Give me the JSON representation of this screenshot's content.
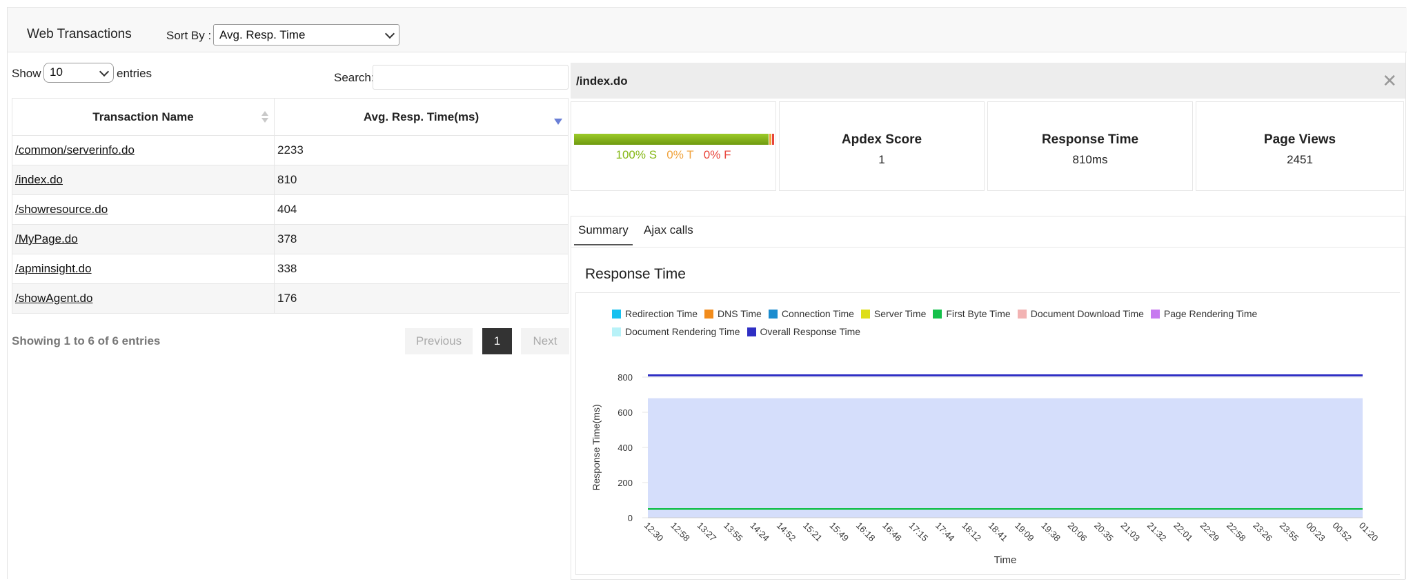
{
  "header": {
    "title": "Web Transactions",
    "sort_by_label": "Sort By :",
    "sort_by_value": "Avg. Resp. Time"
  },
  "table_controls": {
    "show_label": "Show",
    "show_value": "10",
    "entries_label": "entries",
    "search_label": "Search:",
    "search_value": ""
  },
  "table": {
    "columns": [
      "Transaction Name",
      "Avg. Resp. Time(ms)"
    ],
    "rows": [
      {
        "name": "/common/serverinfo.do",
        "value": "2233"
      },
      {
        "name": "/index.do",
        "value": "810"
      },
      {
        "name": "/showresource.do",
        "value": "404"
      },
      {
        "name": "/MyPage.do",
        "value": "378"
      },
      {
        "name": "/apminsight.do",
        "value": "338"
      },
      {
        "name": "/showAgent.do",
        "value": "176"
      }
    ]
  },
  "pagination": {
    "summary": "Showing 1 to 6 of 6 entries",
    "previous": "Previous",
    "current_page": "1",
    "next": "Next"
  },
  "detail": {
    "path": "/index.do",
    "close_icon": "close-icon",
    "apdex_breakdown": {
      "satisfied": "100% S",
      "tolerating": "0% T",
      "frustrated": "0% F",
      "colors": {
        "satisfied": "#86b817",
        "tolerating": "#f0a33d",
        "frustrated": "#e8443a"
      }
    },
    "cards": [
      {
        "title": "Apdex Score",
        "value": "1"
      },
      {
        "title": "Response Time",
        "value": "810ms"
      },
      {
        "title": "Page Views",
        "value": "2451"
      }
    ],
    "tabs": [
      "Summary",
      "Ajax calls"
    ],
    "chart_title": "Response Time"
  },
  "chart_data": {
    "type": "area",
    "xlabel": "Time",
    "ylabel": "Response Time(ms)",
    "ylim": [
      0,
      800
    ],
    "yticks": [
      0,
      200,
      400,
      600,
      800
    ],
    "x": [
      "12:30",
      "12:58",
      "13:27",
      "13:55",
      "14:24",
      "14:52",
      "15:21",
      "15:49",
      "16:18",
      "16:46",
      "17:15",
      "17:44",
      "18:12",
      "18:41",
      "19:09",
      "19:38",
      "20:06",
      "20:35",
      "21:03",
      "21:32",
      "22:01",
      "22:29",
      "22:58",
      "23:26",
      "23:55",
      "00:23",
      "00:52",
      "01:20"
    ],
    "legend_placement": "top",
    "series": [
      {
        "name": "Redirection Time",
        "color": "#17c1f0",
        "value": 0
      },
      {
        "name": "DNS Time",
        "color": "#f28c1c",
        "value": 0
      },
      {
        "name": "Connection Time",
        "color": "#1b8ccf",
        "value": 0
      },
      {
        "name": "Server Time",
        "color": "#dede17",
        "value": 0
      },
      {
        "name": "First Byte Time",
        "color": "#14c04a",
        "value": 50
      },
      {
        "name": "Document Download Time",
        "color": "#f2b3b3",
        "value": 0
      },
      {
        "name": "Page Rendering Time",
        "color": "#c77af0",
        "value": 680
      },
      {
        "name": "Document Rendering Time",
        "color": "#b8f2f8",
        "value": 0
      },
      {
        "name": "Overall Response Time",
        "color": "#2f2fc4",
        "value": 810
      }
    ],
    "fill_color": "#d5defb"
  }
}
